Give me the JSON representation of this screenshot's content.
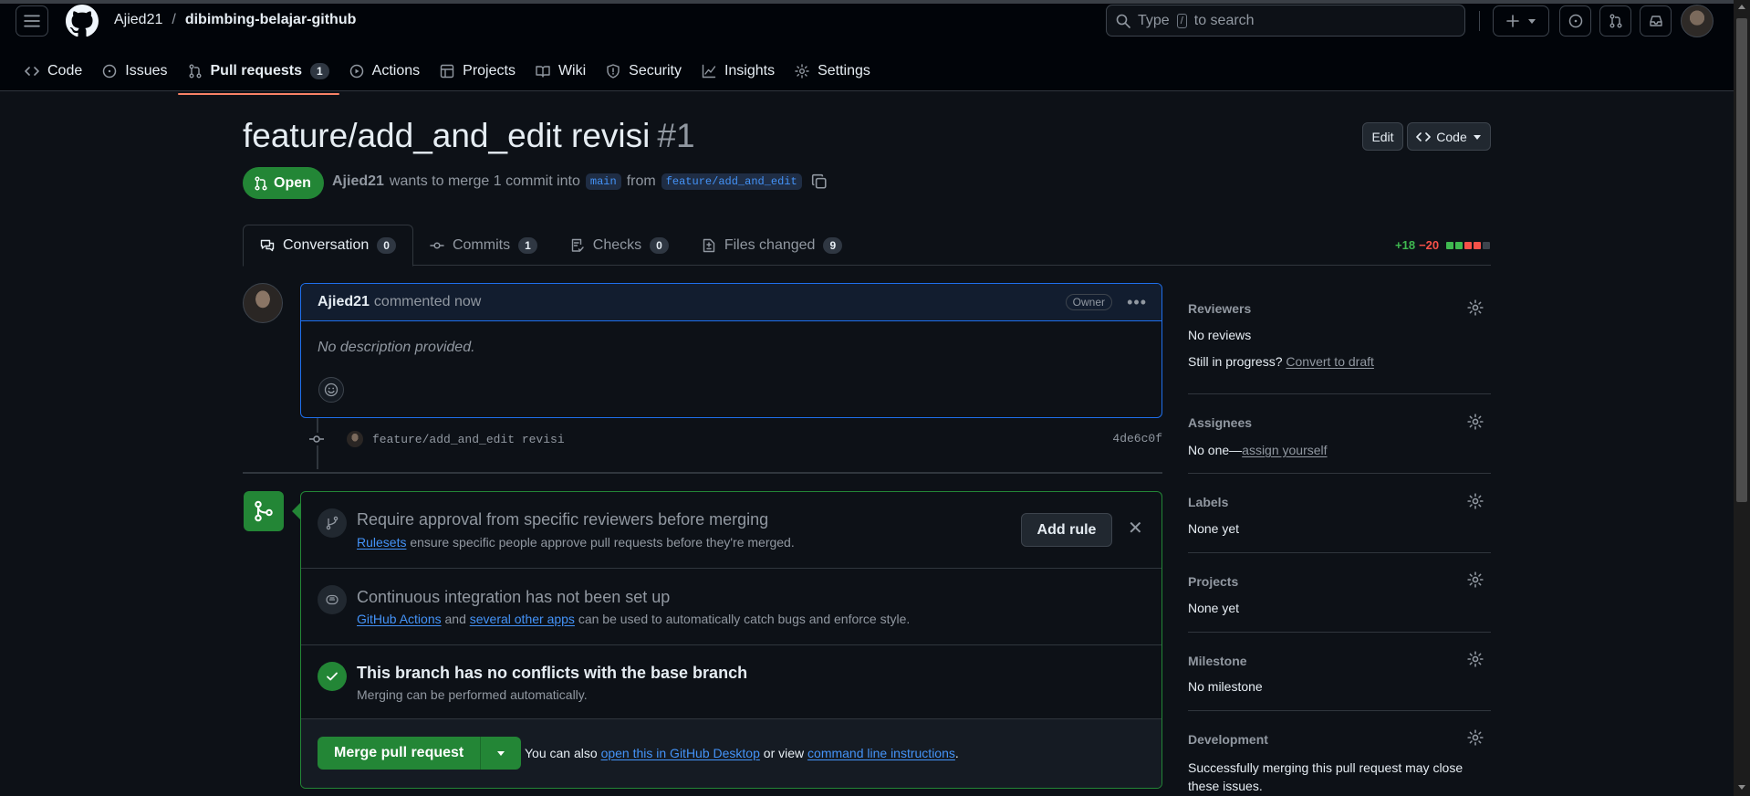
{
  "header": {
    "owner": "Ajied21",
    "separator": "/",
    "repo": "dibimbing-belajar-github",
    "search_prefix": "Type",
    "search_key": "/",
    "search_suffix": "to search"
  },
  "repo_nav": [
    {
      "label": "Code",
      "icon": "code-icon"
    },
    {
      "label": "Issues",
      "icon": "issue-opened-icon"
    },
    {
      "label": "Pull requests",
      "icon": "git-pull-request-icon",
      "count": "1",
      "active": true
    },
    {
      "label": "Actions",
      "icon": "play-icon"
    },
    {
      "label": "Projects",
      "icon": "table-icon"
    },
    {
      "label": "Wiki",
      "icon": "book-icon"
    },
    {
      "label": "Security",
      "icon": "shield-icon"
    },
    {
      "label": "Insights",
      "icon": "graph-icon"
    },
    {
      "label": "Settings",
      "icon": "gear-icon"
    }
  ],
  "pr": {
    "title": "feature/add_and_edit revisi",
    "number": "#1",
    "edit_label": "Edit",
    "code_label": "Code",
    "state": "Open",
    "author": "Ajied21",
    "merge_text": "wants to merge 1 commit into",
    "base_branch": "main",
    "from_text": "from",
    "head_branch": "feature/add_and_edit"
  },
  "tabs": [
    {
      "label": "Conversation",
      "count": "0",
      "icon": "comment-discussion-icon",
      "active": true
    },
    {
      "label": "Commits",
      "count": "1",
      "icon": "git-commit-icon"
    },
    {
      "label": "Checks",
      "count": "0",
      "icon": "checklist-icon"
    },
    {
      "label": "Files changed",
      "count": "9",
      "icon": "file-diff-icon"
    }
  ],
  "diffstat": {
    "additions": "+18",
    "deletions": "−20",
    "add_color": "#3fb950",
    "del_color": "#f85149",
    "neutral_color": "#3d444d"
  },
  "comment": {
    "author": "Ajied21",
    "meta": "commented now",
    "badge": "Owner",
    "body": "No description provided."
  },
  "commit": {
    "message": "feature/add_and_edit revisi",
    "sha": "4de6c0f"
  },
  "merge_box": {
    "ruleset_title": "Require approval from specific reviewers before merging",
    "ruleset_link": "Rulesets",
    "ruleset_desc": "ensure specific people approve pull requests before they're merged.",
    "add_rule_label": "Add rule",
    "ci_title": "Continuous integration has not been set up",
    "ci_link1": "GitHub Actions",
    "ci_and": "and",
    "ci_link2": "several other apps",
    "ci_desc": "can be used to automatically catch bugs and enforce style.",
    "conflict_title": "This branch has no conflicts with the base branch",
    "conflict_desc": "Merging can be performed automatically.",
    "merge_label": "Merge pull request",
    "footer_prefix": "You can also",
    "footer_link1": "open this in GitHub Desktop",
    "footer_mid": "or view",
    "footer_link2": "command line instructions",
    "footer_end": ".",
    "accent": "#238636"
  },
  "sidebar": {
    "reviewers_title": "Reviewers",
    "reviewers_value": "No reviews",
    "draft_prefix": "Still in progress?",
    "draft_link": "Convert to draft",
    "assignees_title": "Assignees",
    "assignees_prefix": "No one—",
    "assignees_link": "assign yourself",
    "labels_title": "Labels",
    "labels_value": "None yet",
    "projects_title": "Projects",
    "projects_value": "None yet",
    "milestone_title": "Milestone",
    "milestone_value": "No milestone",
    "development_title": "Development",
    "development_value": "Successfully merging this pull request may close these issues."
  }
}
